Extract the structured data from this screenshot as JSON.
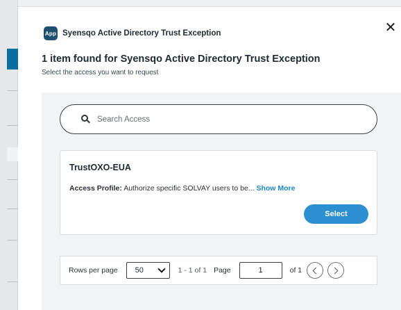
{
  "app": {
    "badge": "App",
    "name": "Syensqo Active Directory Trust Exception"
  },
  "dialog": {
    "close_glyph": "✕",
    "title": "1 item found for Syensqo Active Directory Trust Exception",
    "subtitle": "Select the access you want to request"
  },
  "search": {
    "placeholder": "Search Access",
    "value": ""
  },
  "results": [
    {
      "name": "TrustOXO-EUA",
      "type_label": "Access Profile:",
      "description": "Authorize specific SOLVAY users to be...",
      "show_more": "Show More",
      "select_label": "Select"
    }
  ],
  "pagination": {
    "rows_label": "Rows per page",
    "rows_value": "50",
    "range": "1 - 1 of 1",
    "page_label": "Page",
    "page_value": "1",
    "of_label": "of 1"
  },
  "colors": {
    "accent": "#2b8fd0",
    "link": "#1a86c8",
    "app_badge": "#1f4f6f"
  }
}
